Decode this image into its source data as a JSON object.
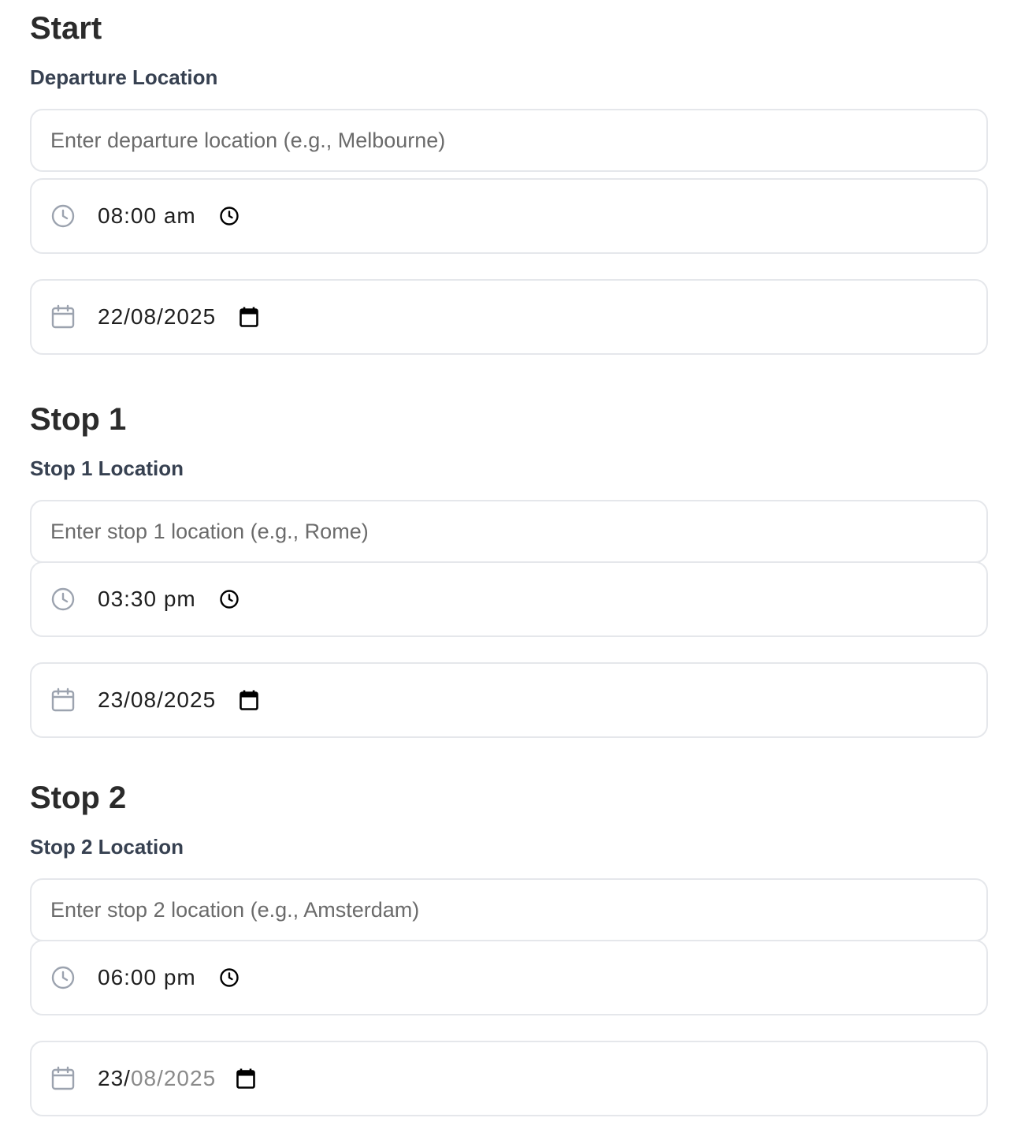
{
  "sections": [
    {
      "title": "Start",
      "location_label": "Departure Location",
      "location_placeholder": "Enter departure location (e.g., Melbourne)",
      "location_value": "",
      "time": "08:00 am",
      "date": "22/08/2025"
    },
    {
      "title": "Stop 1",
      "location_label": "Stop 1 Location",
      "location_placeholder": "Enter stop 1 location (e.g., Rome)",
      "location_value": "",
      "time": "03:30 pm",
      "date": "23/08/2025"
    },
    {
      "title": "Stop 2",
      "location_label": "Stop 2 Location",
      "location_placeholder": "Enter stop 2 location (e.g., Amsterdam)",
      "location_value": "",
      "time": "06:00 pm",
      "date_day": "23/",
      "date_rest": "08/2025"
    }
  ],
  "icons": {
    "time_lead": "clock-icon",
    "time_trail": "clock-picker-icon",
    "date_lead": "calendar-icon",
    "date_trail": "calendar-picker-icon"
  },
  "colors": {
    "border": "#e5e7eb",
    "label": "#374151",
    "placeholder": "#6b6b6b",
    "icon_muted": "#9ca3af"
  }
}
